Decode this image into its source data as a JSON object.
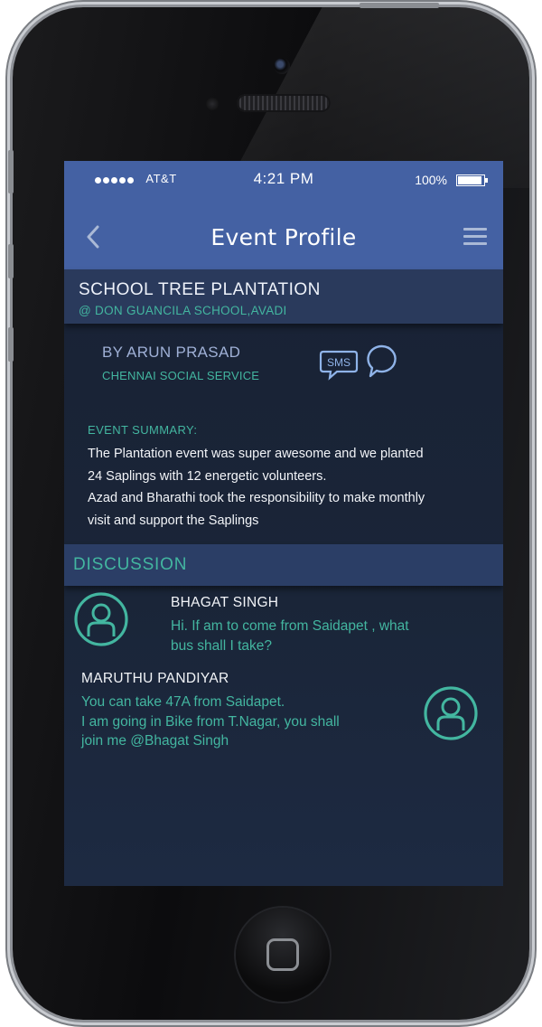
{
  "status_bar": {
    "carrier": "AT&T",
    "time": "4:21 PM",
    "battery": "100%"
  },
  "nav": {
    "title": "Event Profile",
    "back_icon": "chevron-left-icon",
    "menu_icon": "hamburger-menu-icon"
  },
  "event": {
    "name": "SCHOOL TREE PLANTATION",
    "location": "@ DON GUANCILA SCHOOL,AVADI",
    "organizer": "BY ARUN PRASAD",
    "organization": "CHENNAI SOCIAL SERVICE",
    "sms_label": "SMS"
  },
  "summary": {
    "label": "EVENT SUMMARY:",
    "lines": [
      "The Plantation event was super awesome and we planted",
      "24 Saplings with 12 energetic volunteers.",
      "Azad and Bharathi took the responsibility to make monthly",
      "visit and support the Saplings"
    ]
  },
  "discussion": {
    "title": "DISCUSSION",
    "messages": [
      {
        "author": "BHAGAT SINGH",
        "lines": [
          "Hi. If am to come from Saidapet , what",
          "bus shall I take?"
        ]
      },
      {
        "author": "MARUTHU PANDIYAR",
        "lines": [
          "You can take 47A from Saidapet.",
          "I am going in Bike from T.Nagar, you shall",
          "join me @Bhagat Singh"
        ]
      }
    ]
  },
  "colors": {
    "app_bar": "#4461a3",
    "accent": "#43b6a0",
    "screen_bg": "#1a2538"
  }
}
